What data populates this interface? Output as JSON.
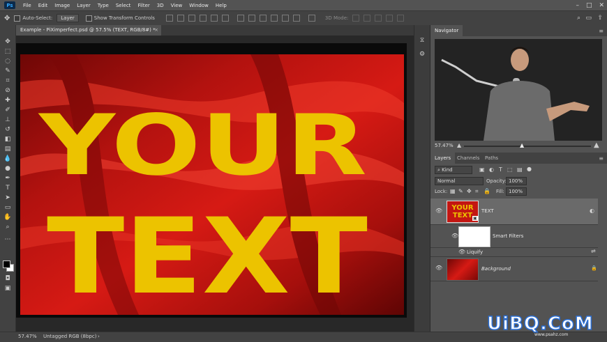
{
  "menubar": {
    "logo": "Ps",
    "items": [
      "File",
      "Edit",
      "Image",
      "Layer",
      "Type",
      "Select",
      "Filter",
      "3D",
      "View",
      "Window",
      "Help"
    ]
  },
  "options": {
    "auto_select_label": "Auto-Select:",
    "auto_select_value": "Layer",
    "transform_label": "Show Transform Controls",
    "mode_3d": "3D Mode:"
  },
  "document": {
    "tab_title": "Example - PiXimperfect.psd @ 57.5% (TEXT, RGB/8#) *",
    "artwork_line1": "YOUR",
    "artwork_line2": "TEXT"
  },
  "status": {
    "zoom": "57.47%",
    "profile": "Untagged RGB (8bpc)"
  },
  "navigator": {
    "tab": "Navigator",
    "zoom": "57.47%"
  },
  "layers_panel": {
    "tabs": [
      "Layers",
      "Channels",
      "Paths"
    ],
    "filter_kind": "Kind",
    "blend_mode": "Normal",
    "opacity_label": "Opacity:",
    "opacity_value": "100%",
    "lock_label": "Lock:",
    "fill_label": "Fill:",
    "fill_value": "100%",
    "thumb_text_line1": "YOUR",
    "thumb_text_line2": "TEXT",
    "layers": [
      {
        "name": "TEXT"
      },
      {
        "name": "Smart Filters"
      },
      {
        "name": "Liquify"
      },
      {
        "name": "Background"
      }
    ]
  },
  "watermark": {
    "main": "UiBQ.CoM",
    "sub": "www.psahz.com"
  },
  "colors": {
    "text_yellow": "#ecc300",
    "cloth_red": "#b3120f",
    "ui_dark": "#282828",
    "ui_panel": "#535353"
  }
}
